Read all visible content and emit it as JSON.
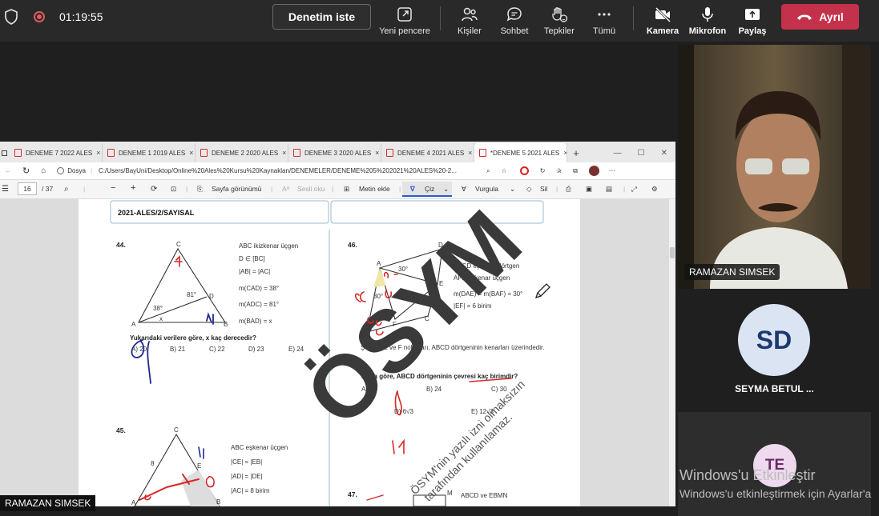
{
  "topbar": {
    "timer": "01:19:55",
    "request_control_label": "Denetim iste",
    "new_window_label": "Yeni pencere",
    "people_label": "Kişiler",
    "chat_label": "Sohbet",
    "reactions_label": "Tepkiler",
    "more_label": "Tümü",
    "camera_label": "Kamera",
    "mic_label": "Mikrofon",
    "share_label": "Paylaş",
    "leave_label": "Ayrıl"
  },
  "browser": {
    "tabs": [
      {
        "label": "DENEME 7 2022 ALES"
      },
      {
        "label": "DENEME 1 2019 ALES"
      },
      {
        "label": "DENEME 2 2020 ALES"
      },
      {
        "label": "DENEME 3 2020 ALES"
      },
      {
        "label": "DENEME 4 2021 ALES"
      },
      {
        "label": "*DENEME 5 2021 ALES"
      }
    ],
    "file_label": "Dosya",
    "url": "C:/Users/BayUni/Desktop/Online%20Ales%20Kursu%20Kaynaklan/DENEMELER/DENEME%205%202021%20ALES%20-2...",
    "page_current": "16",
    "page_total": "/ 37",
    "page_view_label": "Sayfa görünümü",
    "read_aloud_label": "Sesli oku",
    "add_text_label": "Metin ekle",
    "draw_label": "Çiz",
    "highlight_label": "Vurgula",
    "erase_label": "Sil"
  },
  "pdf": {
    "header": "2021-ALES/2/SAYISAL",
    "q44": {
      "number": "44.",
      "given": [
        "ABC ikizkenar üçgen",
        "D ∈ [BC]",
        "|AB| = |AC|",
        "m(CAD) = 38°",
        "m(ADC) = 81°",
        "m(BAD) = x"
      ],
      "question": "Yukarıdaki verilere göre, x kaç derecedir?",
      "options": [
        "A) 20",
        "B) 21",
        "C) 22",
        "D) 23",
        "E) 24"
      ],
      "fig_labels": {
        "A": "A",
        "B": "B",
        "C": "C",
        "D": "D",
        "a38": "38°",
        "a81": "81°",
        "x": "x"
      }
    },
    "q46": {
      "number": "46.",
      "given": [
        "ABCD eşkenar dörtgen",
        "AFE eşkenar üçgen",
        "m(DAE) = m(BAF) = 30°",
        "|EF| = 6 birim"
      ],
      "desc": "Şekilde E ve F noktaları, ABCD dörtgeninin kenarları üzerindedir.",
      "question": "Buna göre, ABCD dörtgeninin çevresi kaç birimdir?",
      "options": [
        "A) 18",
        "B) 24",
        "C) 30",
        "D) 6√3",
        "E) 12√3"
      ],
      "fig_labels": {
        "A": "A",
        "B": "B",
        "C": "C",
        "D": "D",
        "E": "E",
        "F": "F",
        "a30a": "30°",
        "a30b": "30°",
        "six": "6"
      }
    },
    "q45": {
      "number": "45.",
      "given": [
        "ABC eşkenar üçgen",
        "|CE| = |EB|",
        "|AD| = |DE|",
        "|AC| = 8 birim"
      ],
      "fig_labels": {
        "C": "C",
        "E": "E",
        "A": "A",
        "B": "B",
        "eight": "8"
      }
    },
    "q47": {
      "number": "47.",
      "given": [
        "ABCD ve EBMN"
      ],
      "fig_labels": {
        "M": "M"
      }
    },
    "watermark_big": "ÖSYM",
    "watermark_small1": "ÖSYM'nin yazılı izni olmaksızın",
    "watermark_small2": "tarafından kullanılamaz."
  },
  "presenter_label": "RAMAZAN SIMSEK",
  "participants": [
    {
      "name": "RAMAZAN SIMSEK"
    },
    {
      "name": "SEYMA BETUL ...",
      "initials": "SD"
    },
    {
      "initials": "TE"
    }
  ],
  "activation": {
    "title": "Windows'u Etkinleştir",
    "subtitle": "Windows'u etkinleştirmek için Ayarlar'a"
  },
  "colors": {
    "leave": "#c4314b",
    "avatar_sd": "#dbe4f3",
    "avatar_te": "#efd9ee",
    "ink_red": "#d62828",
    "ink_blue": "#1c2a8c"
  }
}
